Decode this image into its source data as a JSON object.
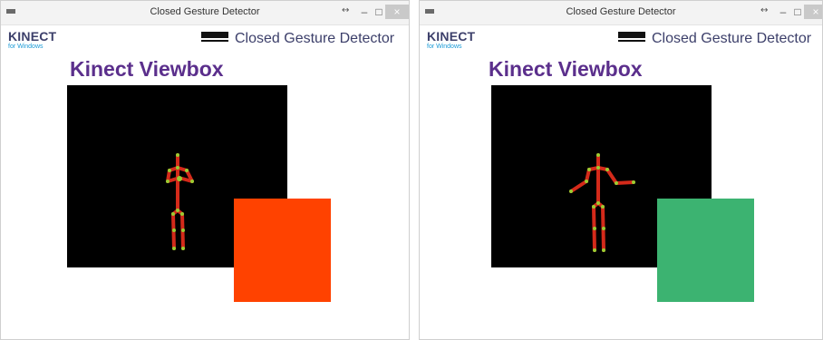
{
  "windows": [
    {
      "title": "Closed Gesture Detector",
      "brand": {
        "name": "KINECT",
        "sub": "for Windows"
      },
      "app_title": "Closed Gesture Detector",
      "viewbox_title": "Kinect Viewbox",
      "controls": {
        "restore": "↔",
        "minimize": "–",
        "maximize": "□",
        "close": "×"
      },
      "indicator_color": "#ff4200",
      "pose": "arms-closed"
    },
    {
      "title": "Closed Gesture Detector",
      "brand": {
        "name": "KINECT",
        "sub": "for Windows"
      },
      "app_title": "Closed Gesture Detector",
      "viewbox_title": "Kinect Viewbox",
      "controls": {
        "restore": "↔",
        "minimize": "–",
        "maximize": "□",
        "close": "×"
      },
      "indicator_color": "#3cb371",
      "pose": "arms-open"
    }
  ],
  "colors": {
    "skeleton_bone": "#d42a1a",
    "skeleton_joint": "#9acd32",
    "viewport_bg": "#000000"
  }
}
